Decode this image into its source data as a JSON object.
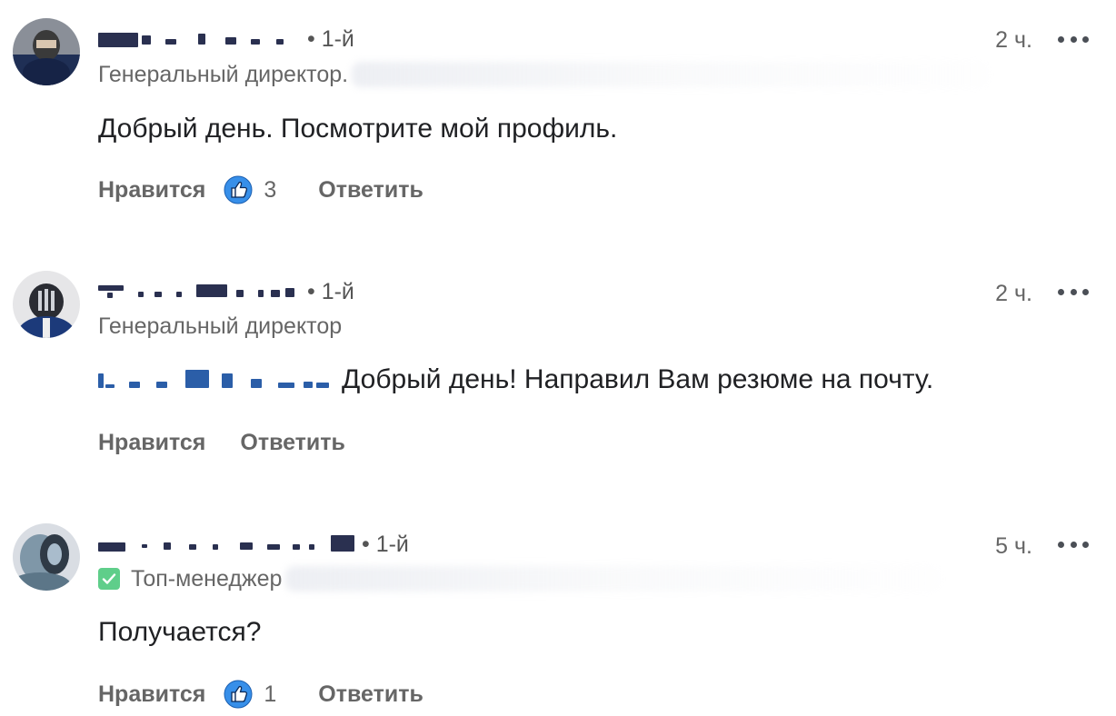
{
  "comments": [
    {
      "degree": "• 1-й",
      "time": "2 ч.",
      "headline": "Генеральный директор.",
      "body": "Добрый день. Посмотрите мой профиль.",
      "like_label": "Нравится",
      "like_count": "3",
      "reply_label": "Ответить"
    },
    {
      "degree": "• 1-й",
      "time": "2 ч.",
      "headline": "Генеральный директор",
      "body": "Добрый день! Направил Вам резюме на почту.",
      "like_label": "Нравится",
      "reply_label": "Ответить"
    },
    {
      "degree": "• 1-й",
      "time": "5 ч.",
      "headline": "Топ-менеджер",
      "body": "Получается?",
      "like_label": "Нравится",
      "like_count": "1",
      "reply_label": "Ответить"
    }
  ],
  "colors": {
    "like_blue": "#378fe9",
    "verified_green": "#5fce8a",
    "mention_blue": "#2b5ea8"
  },
  "icons": {
    "like": "thumbs-up-icon",
    "more": "more-options-icon",
    "verified": "verified-check-icon"
  }
}
